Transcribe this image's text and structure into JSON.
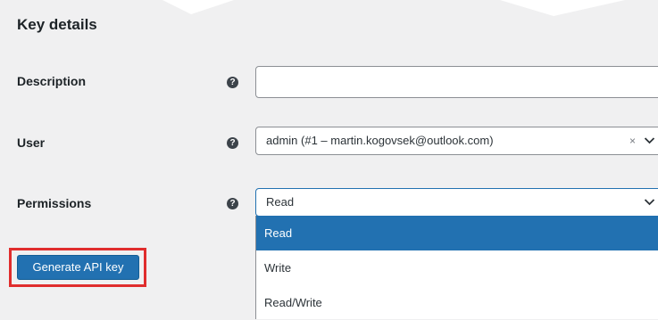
{
  "section": {
    "title": "Key details"
  },
  "fields": {
    "description": {
      "label": "Description",
      "value": ""
    },
    "user": {
      "label": "User",
      "value": "admin (#1 – martin.kogovsek@outlook.com)",
      "clear_icon": "close-icon"
    },
    "permissions": {
      "label": "Permissions",
      "value": "Read",
      "options": [
        "Read",
        "Write",
        "Read/Write"
      ],
      "highlighted_option": "Read"
    }
  },
  "help_icon": {
    "glyph": "?"
  },
  "actions": {
    "generate_label": "Generate API key"
  },
  "colors": {
    "background": "#f0f0f1",
    "accent": "#2271b1",
    "highlight_border": "#e02d2d"
  }
}
